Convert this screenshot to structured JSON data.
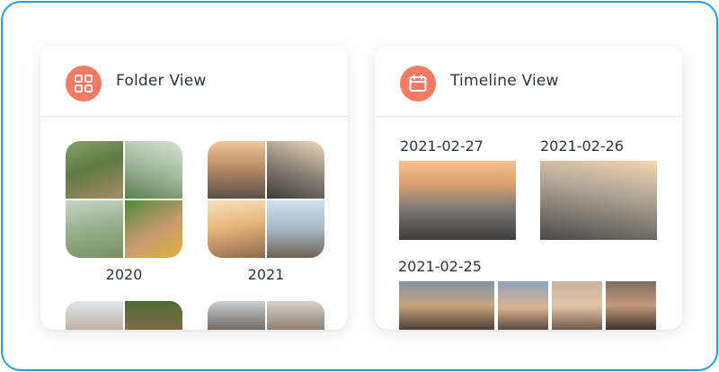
{
  "folder_view": {
    "title": "Folder View",
    "icon": "grid-icon",
    "albums": [
      {
        "label": "2020"
      },
      {
        "label": "2021"
      }
    ]
  },
  "timeline_view": {
    "title": "Timeline View",
    "icon": "calendar-icon",
    "dates": [
      "2021-02-27",
      "2021-02-26",
      "2021-02-25"
    ]
  },
  "colors": {
    "accent": "#f47a62",
    "frame_border": "#1aa3e3",
    "text": "#2f3438"
  }
}
